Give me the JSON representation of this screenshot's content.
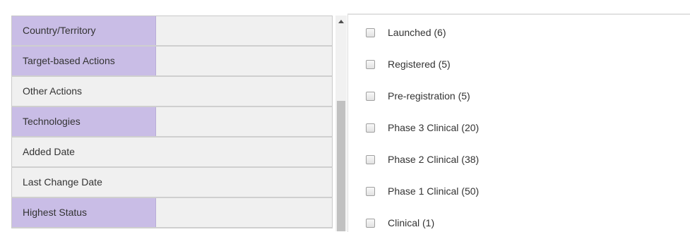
{
  "filters": [
    {
      "label": "Country/Territory",
      "highlighted": true
    },
    {
      "label": "Target-based Actions",
      "highlighted": true
    },
    {
      "label": "Other Actions",
      "highlighted": false
    },
    {
      "label": "Technologies",
      "highlighted": true
    },
    {
      "label": "Added Date",
      "highlighted": false
    },
    {
      "label": "Last Change Date",
      "highlighted": false
    },
    {
      "label": "Highest Status",
      "highlighted": true
    }
  ],
  "statuses": [
    {
      "label": "Launched (6)",
      "checked": false
    },
    {
      "label": "Registered (5)",
      "checked": false
    },
    {
      "label": "Pre-registration (5)",
      "checked": false
    },
    {
      "label": "Phase 3 Clinical (20)",
      "checked": false
    },
    {
      "label": "Phase 2 Clinical (38)",
      "checked": false
    },
    {
      "label": "Phase 1 Clinical (50)",
      "checked": false
    },
    {
      "label": "Clinical (1)",
      "checked": false
    }
  ],
  "colors": {
    "highlight": "#c9bde6",
    "row_background": "#f0f0f0",
    "scroll_thumb": "#c1c1c1"
  }
}
